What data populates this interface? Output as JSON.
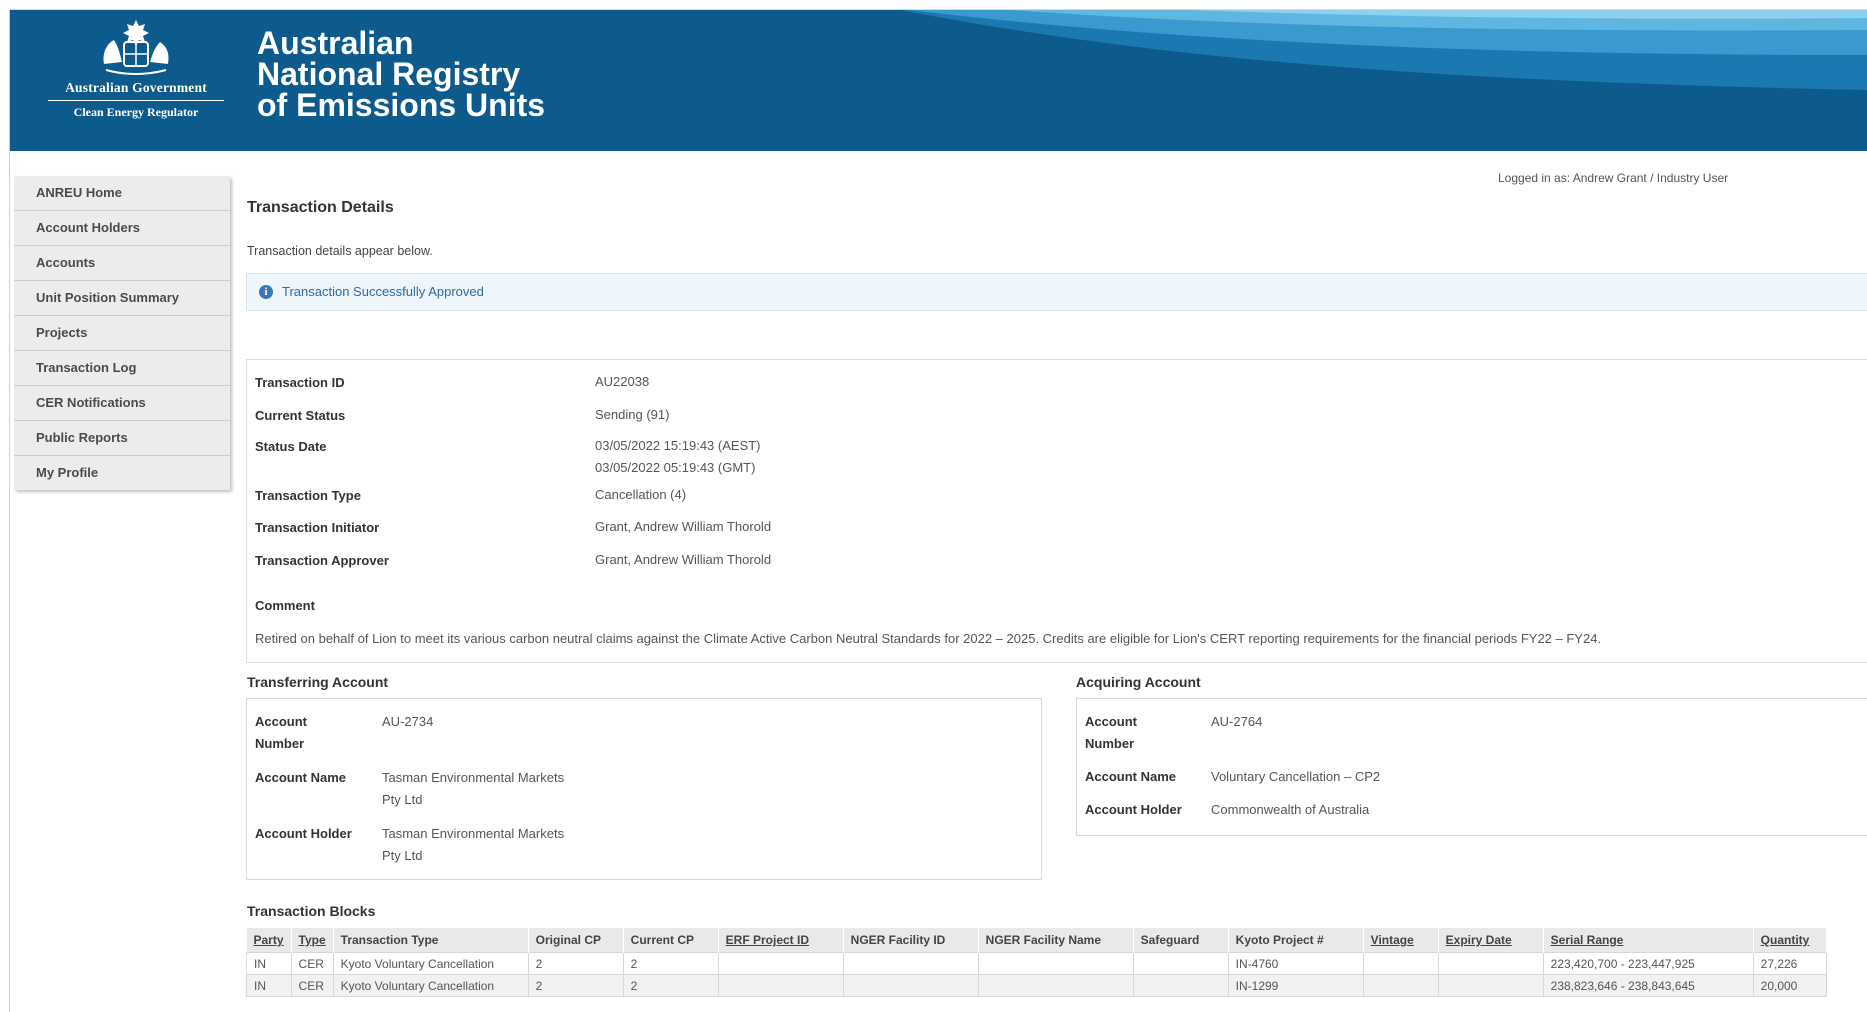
{
  "header": {
    "gov_line1": "Australian Government",
    "gov_line2": "Clean Energy Regulator",
    "title_line1": "Australian",
    "title_line2": "National Registry",
    "title_line3": "of Emissions Units",
    "brand_color": "#0d5a8c"
  },
  "sidebar": {
    "items": [
      {
        "label": "ANREU Home"
      },
      {
        "label": "Account Holders"
      },
      {
        "label": "Accounts"
      },
      {
        "label": "Unit Position Summary"
      },
      {
        "label": "Projects"
      },
      {
        "label": "Transaction Log"
      },
      {
        "label": "CER Notifications"
      },
      {
        "label": "Public Reports"
      },
      {
        "label": "My Profile"
      }
    ]
  },
  "user": {
    "logged_in_label": "Logged in as:",
    "logged_in_user": "Andrew Grant / Industry User"
  },
  "page": {
    "title": "Transaction Details",
    "subtitle": "Transaction details appear below.",
    "alert_message": "Transaction Successfully Approved"
  },
  "details": {
    "transaction_id": {
      "label": "Transaction ID",
      "value": "AU22038"
    },
    "current_status": {
      "label": "Current Status",
      "value": "Sending (91)"
    },
    "status_date": {
      "label": "Status Date",
      "value_line1": "03/05/2022 15:19:43 (AEST)",
      "value_line2": "03/05/2022 05:19:43 (GMT)"
    },
    "transaction_type": {
      "label": "Transaction Type",
      "value": "Cancellation (4)"
    },
    "transaction_initiator": {
      "label": "Transaction Initiator",
      "value": "Grant, Andrew William Thorold"
    },
    "transaction_approver": {
      "label": "Transaction Approver",
      "value": "Grant, Andrew William Thorold"
    },
    "comment": {
      "label": "Comment",
      "value": "Retired on behalf of Lion to meet its various carbon neutral claims against the Climate Active Carbon Neutral Standards for 2022 – 2025. Credits are eligible for Lion's CERT reporting requirements for the financial periods FY22 – FY24."
    }
  },
  "transferring": {
    "section_label": "Transferring Account",
    "account_number_label_1": "Account",
    "account_number_label_2": "Number",
    "account_number": "AU-2734",
    "account_name_label": "Account Name",
    "account_name_line1": "Tasman Environmental Markets",
    "account_name_line2": "Pty Ltd",
    "account_holder_label": "Account Holder",
    "account_holder_line1": "Tasman Environmental Markets",
    "account_holder_line2": "Pty Ltd"
  },
  "acquiring": {
    "section_label": "Acquiring Account",
    "account_number_label_1": "Account",
    "account_number_label_2": "Number",
    "account_number": "AU-2764",
    "account_name_label": "Account Name",
    "account_name": "Voluntary Cancellation – CP2",
    "account_holder_label": "Account Holder",
    "account_holder": "Commonwealth of Australia"
  },
  "blocks": {
    "section_label": "Transaction Blocks",
    "headers": [
      "Party",
      "Type",
      "Transaction Type",
      "Original CP",
      "Current CP",
      "ERF Project ID",
      "NGER Facility ID",
      "NGER Facility Name",
      "Safeguard",
      "Kyoto Project #",
      "Vintage",
      "Expiry Date",
      "Serial Range",
      "Quantity"
    ],
    "rows": [
      [
        "IN",
        "CER",
        "Kyoto Voluntary Cancellation",
        "2",
        "2",
        "",
        "",
        "",
        "",
        "IN-4760",
        "",
        "",
        "223,420,700 - 223,447,925",
        "27,226"
      ],
      [
        "IN",
        "CER",
        "Kyoto Voluntary Cancellation",
        "2",
        "2",
        "",
        "",
        "",
        "",
        "IN-1299",
        "",
        "",
        "238,823,646 - 238,843,645",
        "20,000"
      ]
    ]
  }
}
